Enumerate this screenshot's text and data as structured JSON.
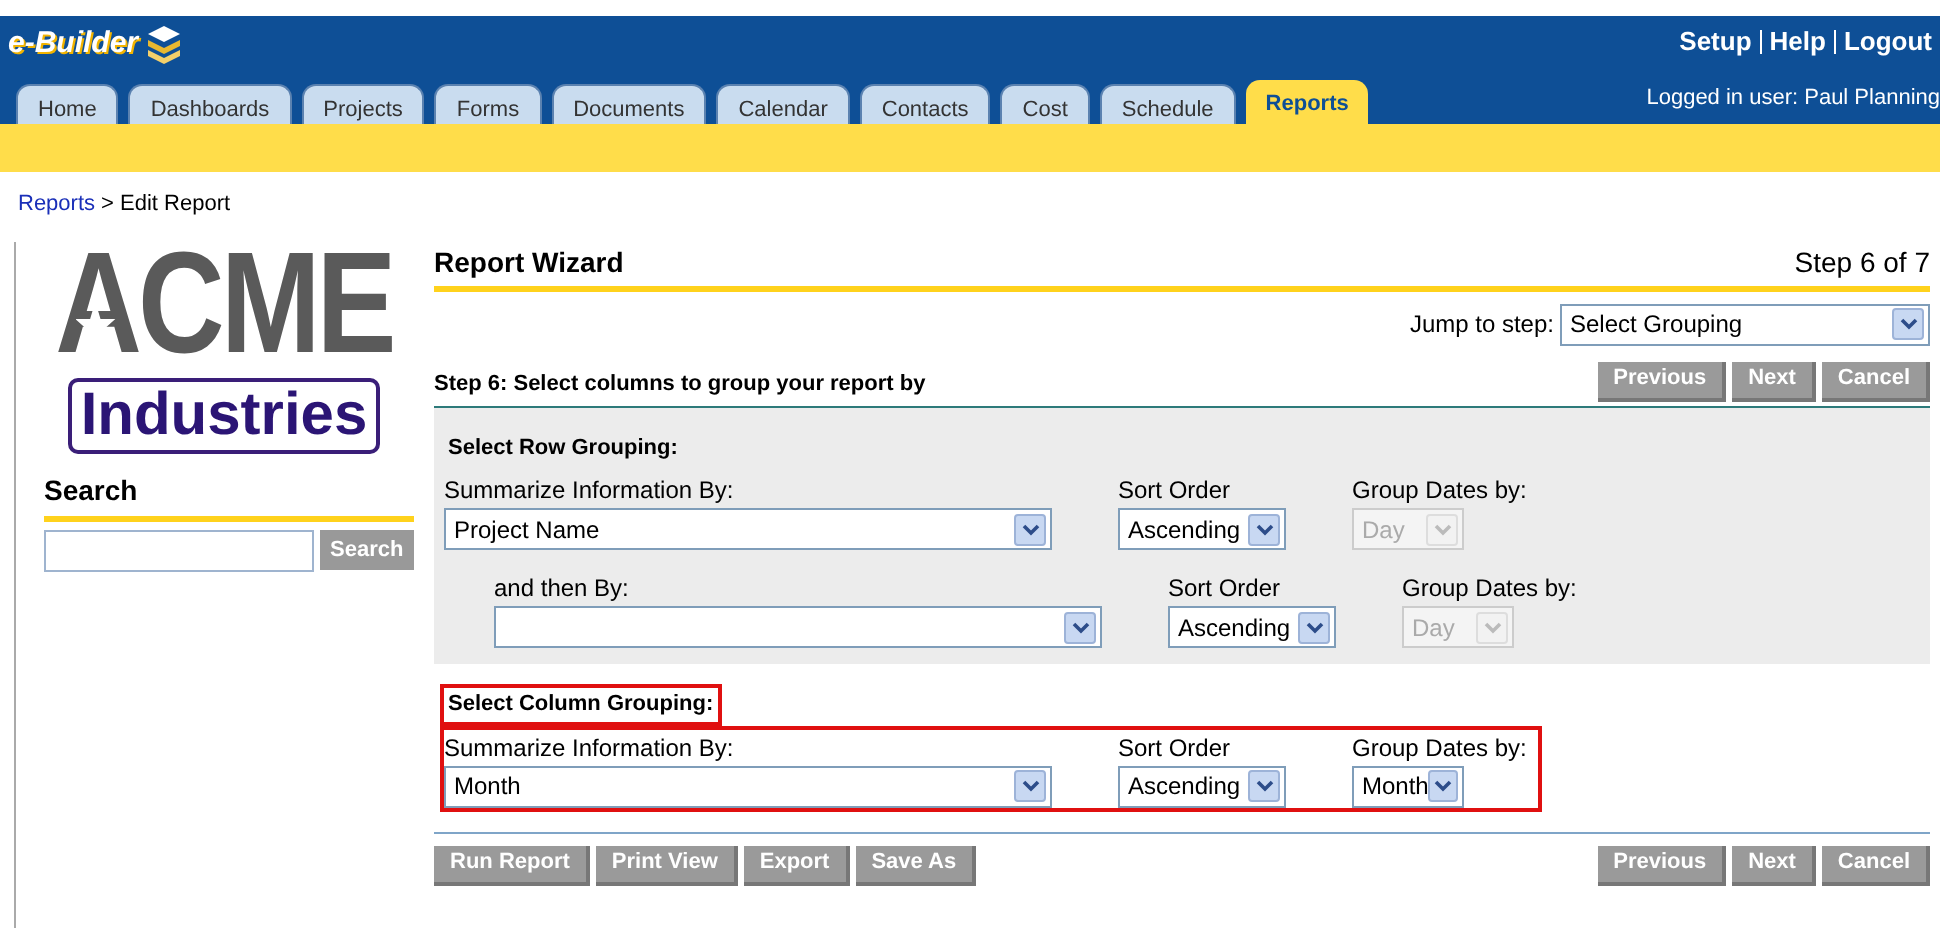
{
  "header": {
    "brand": "e-Builder",
    "links": [
      "Setup",
      "Help",
      "Logout"
    ],
    "user": "Logged in user: Paul Planning"
  },
  "tabs": [
    {
      "label": "Home",
      "selected": false
    },
    {
      "label": "Dashboards",
      "selected": false
    },
    {
      "label": "Projects",
      "selected": false
    },
    {
      "label": "Forms",
      "selected": false
    },
    {
      "label": "Documents",
      "selected": false
    },
    {
      "label": "Calendar",
      "selected": false
    },
    {
      "label": "Contacts",
      "selected": false
    },
    {
      "label": "Cost",
      "selected": false
    },
    {
      "label": "Schedule",
      "selected": false
    },
    {
      "label": "Reports",
      "selected": true
    }
  ],
  "breadcrumb": {
    "link": "Reports",
    "current": "> Edit Report"
  },
  "sidebar": {
    "logo_top": "ACME",
    "logo_bottom": "Industries",
    "search_title": "Search",
    "search_button": "Search"
  },
  "wizard": {
    "title": "Report Wizard",
    "step": "Step 6 of 7",
    "jump_label": "Jump to step:",
    "jump_value": "Select Grouping",
    "step_heading": "Step 6: Select columns to group your report by",
    "nav_buttons": [
      "Previous",
      "Next",
      "Cancel"
    ]
  },
  "groupings": [
    {
      "title": "Select Row Grouping:",
      "highlighted": false,
      "rows": [
        {
          "label": "Summarize Information By:",
          "value": "Project Name",
          "sort_label": "Sort Order",
          "sort_value": "Ascending",
          "dates_label": "Group Dates by:",
          "dates_value": "Day",
          "dates_disabled": true,
          "indented": false
        },
        {
          "label": "and then By:",
          "sort_label": "Sort Order",
          "sort_value": "Ascending",
          "dates_label": "Group Dates by:",
          "dates_value": "Day",
          "dates_disabled": true,
          "indented": true
        }
      ]
    },
    {
      "title": "Select Column Grouping:",
      "highlighted": true,
      "rows": [
        {
          "label": "Summarize Information By:",
          "value": "Month",
          "sort_label": "Sort Order",
          "sort_value": "Ascending",
          "dates_label": "Group Dates by:",
          "dates_value": "Month",
          "dates_disabled": false,
          "indented": false
        }
      ]
    }
  ],
  "footer": {
    "left_buttons": [
      "Run Report",
      "Print View",
      "Export",
      "Save As"
    ],
    "right_buttons": [
      "Previous",
      "Next",
      "Cancel"
    ]
  }
}
